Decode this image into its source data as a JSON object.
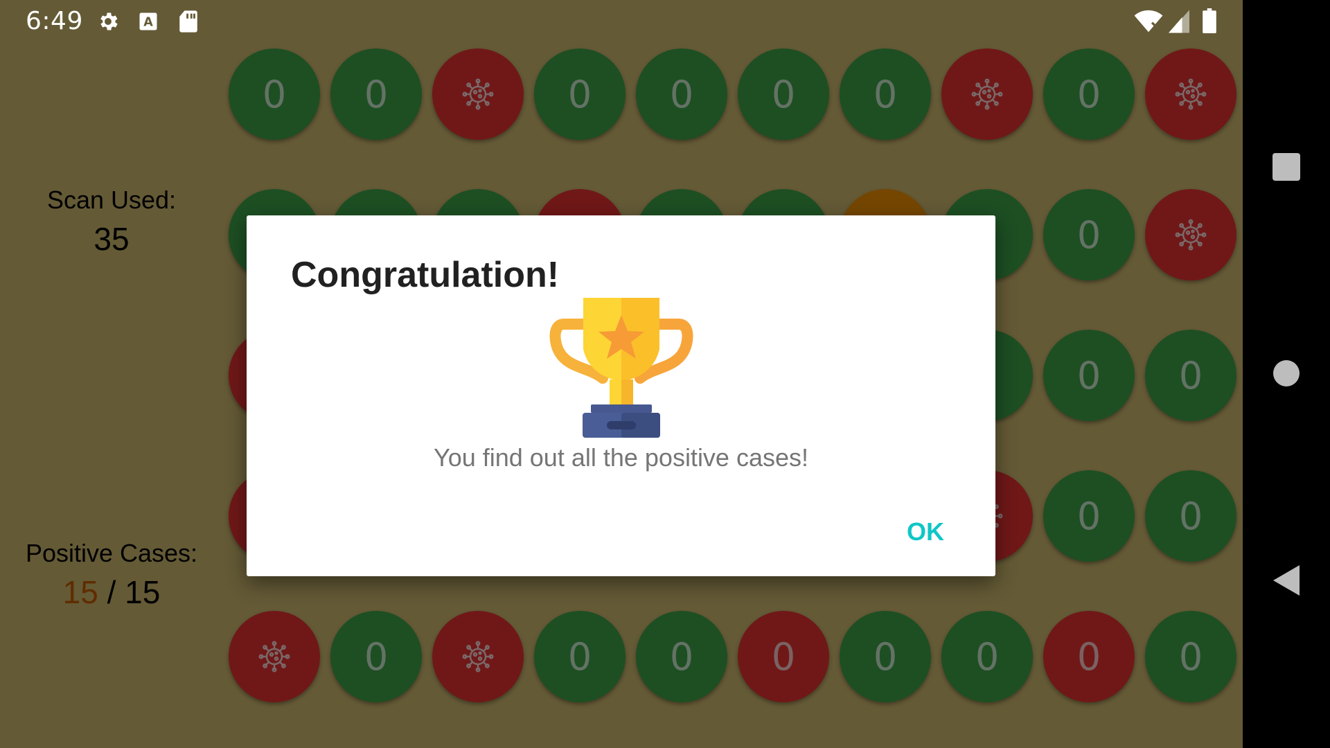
{
  "status_bar": {
    "time": "6:49",
    "left_icons": [
      "gear-icon",
      "a-letter-icon",
      "sd-card-icon"
    ],
    "right_icons": [
      "wifi-icon",
      "cell-signal-icon",
      "battery-icon"
    ]
  },
  "sidebar": {
    "scan_label": "Scan Used:",
    "scan_value": "35",
    "positive_label": "Positive Cases:",
    "positive_found": "15",
    "positive_separator": "/",
    "positive_total": "15"
  },
  "grid": {
    "rows": [
      [
        {
          "state": "green",
          "label": "0"
        },
        {
          "state": "green",
          "label": "0"
        },
        {
          "state": "red",
          "icon": "virus-icon"
        },
        {
          "state": "green",
          "label": "0"
        },
        {
          "state": "green",
          "label": "0"
        },
        {
          "state": "green",
          "label": "0"
        },
        {
          "state": "green",
          "label": "0"
        },
        {
          "state": "red",
          "icon": "virus-icon"
        },
        {
          "state": "green",
          "label": "0"
        },
        {
          "state": "red",
          "icon": "virus-icon"
        }
      ],
      [
        {
          "state": "green"
        },
        {
          "state": "green"
        },
        {
          "state": "green"
        },
        {
          "state": "red"
        },
        {
          "state": "green"
        },
        {
          "state": "green"
        },
        {
          "state": "orange"
        },
        {
          "state": "green"
        },
        {
          "state": "green",
          "label": "0"
        },
        {
          "state": "red",
          "icon": "virus-icon"
        }
      ],
      [
        {
          "state": "red"
        },
        {
          "state": "green"
        },
        {
          "state": "green"
        },
        {
          "state": "green"
        },
        {
          "state": "green"
        },
        {
          "state": "green"
        },
        {
          "state": "green"
        },
        {
          "state": "green"
        },
        {
          "state": "green",
          "label": "0"
        },
        {
          "state": "green",
          "label": "0"
        }
      ],
      [
        {
          "state": "red"
        },
        {
          "state": "green"
        },
        {
          "state": "green"
        },
        {
          "state": "green"
        },
        {
          "state": "green"
        },
        {
          "state": "green"
        },
        {
          "state": "green"
        },
        {
          "state": "red",
          "icon": "virus-icon"
        },
        {
          "state": "green",
          "label": "0"
        },
        {
          "state": "green",
          "label": "0"
        }
      ],
      [
        {
          "state": "red",
          "icon": "virus-icon"
        },
        {
          "state": "green",
          "label": "0"
        },
        {
          "state": "red",
          "icon": "virus-icon"
        },
        {
          "state": "green",
          "label": "0"
        },
        {
          "state": "green",
          "label": "0"
        },
        {
          "state": "red",
          "label": "0"
        },
        {
          "state": "green",
          "label": "0"
        },
        {
          "state": "green",
          "label": "0"
        },
        {
          "state": "red",
          "label": "0"
        },
        {
          "state": "green",
          "label": "0"
        }
      ]
    ]
  },
  "dialog": {
    "title": "Congratulation!",
    "icon": "trophy-icon",
    "message": "You find out all the positive cases!",
    "ok_label": "OK"
  },
  "nav_bar": {
    "buttons": [
      "recents-square-icon",
      "home-circle-icon",
      "back-triangle-icon"
    ]
  },
  "colors": {
    "accent": "#10c6c6",
    "cell_green": "#3b9e46",
    "cell_red": "#e03131",
    "cell_orange": "#ea8c00",
    "positive_highlight": "#c05800"
  }
}
